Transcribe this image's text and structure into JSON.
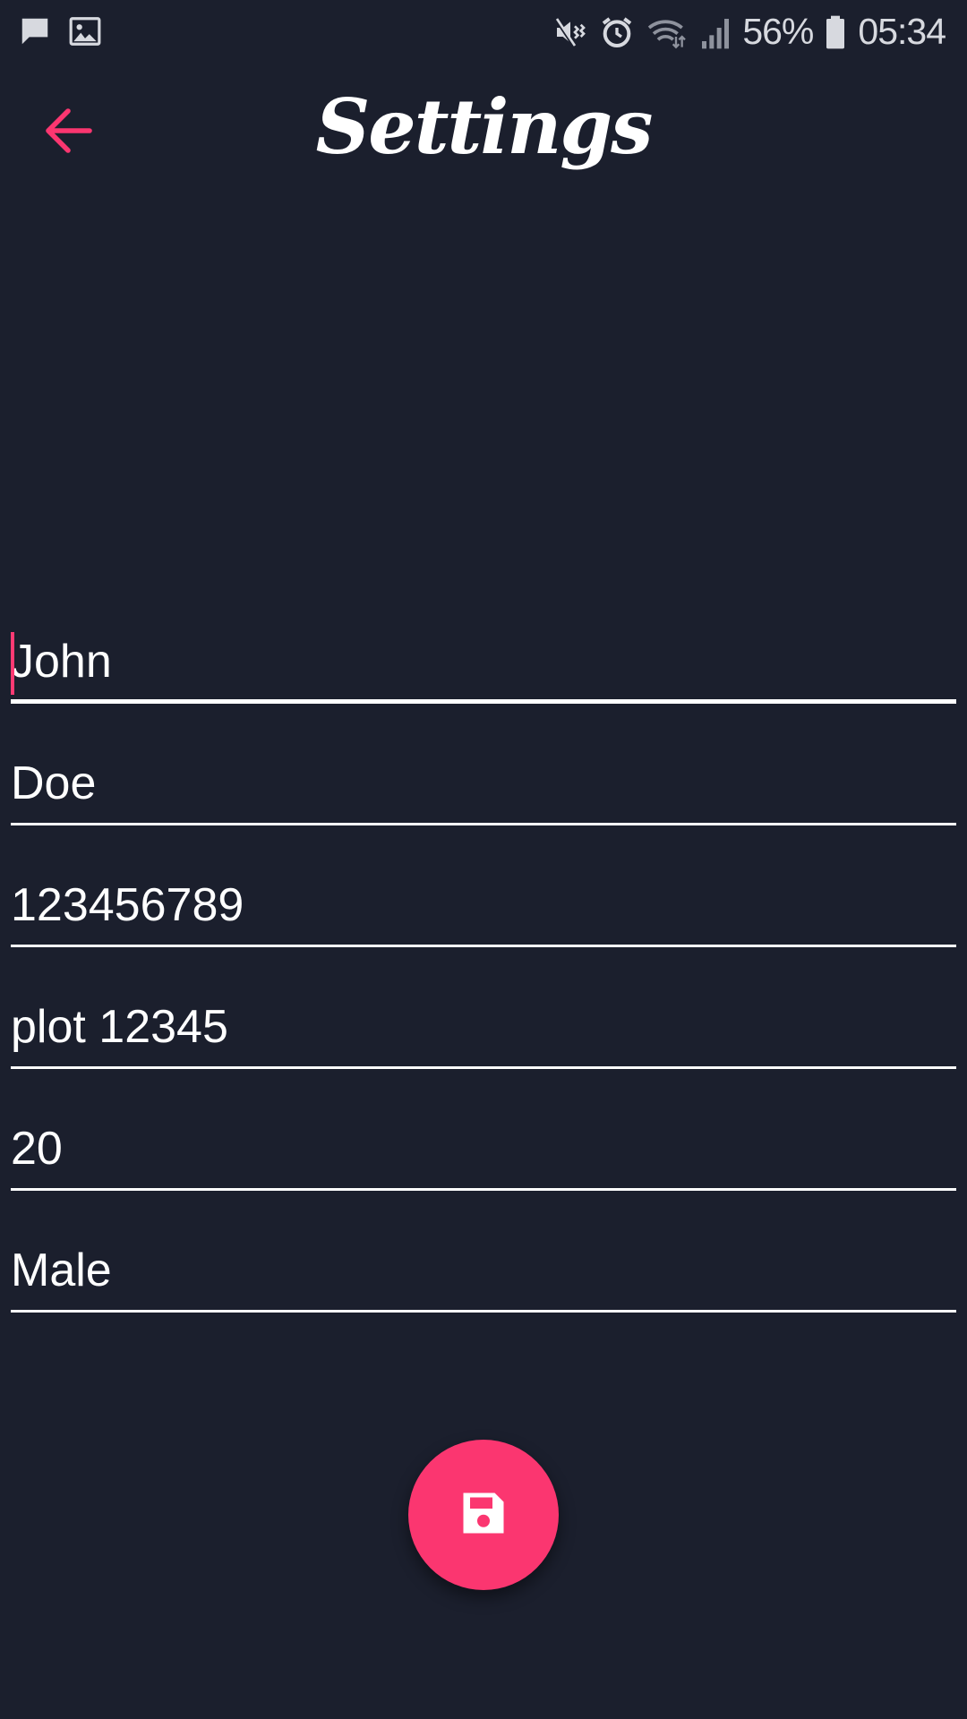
{
  "status_bar": {
    "left_icons": [
      "message-icon",
      "image-icon"
    ],
    "right_icons": [
      "vibrate-mute-icon",
      "alarm-icon",
      "wifi-icon",
      "signal-icon",
      "battery-icon"
    ],
    "battery_percent": "56%",
    "time": "05:34"
  },
  "app_bar": {
    "title": "Settings",
    "back_icon": "arrow-left-icon"
  },
  "form": {
    "first_name": "John",
    "last_name": "Doe",
    "phone": "123456789",
    "address": "plot 12345",
    "age": "20",
    "gender": "Male"
  },
  "fab": {
    "icon": "floppy-disk-icon"
  },
  "colors": {
    "background": "#1b1f2d",
    "accent": "#fb3670",
    "text": "#ffffff"
  }
}
